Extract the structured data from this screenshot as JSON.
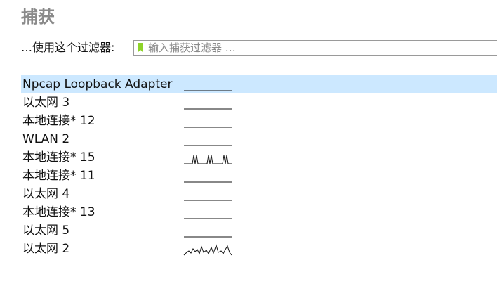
{
  "section": {
    "title": "捕获"
  },
  "filter": {
    "label": "…使用这个过滤器:",
    "placeholder": "输入捕获过滤器 …",
    "bookmark_color": "#8ed32a"
  },
  "interfaces": [
    {
      "name": "Npcap Loopback Adapter",
      "traffic": "flat",
      "selected": true
    },
    {
      "name": "以太网 3",
      "traffic": "flat",
      "selected": false
    },
    {
      "name": "本地连接* 12",
      "traffic": "flat",
      "selected": false
    },
    {
      "name": "WLAN 2",
      "traffic": "flat",
      "selected": false
    },
    {
      "name": "本地连接* 15",
      "traffic": "spikes",
      "selected": false
    },
    {
      "name": "本地连接* 11",
      "traffic": "flat",
      "selected": false
    },
    {
      "name": "以太网 4",
      "traffic": "flat",
      "selected": false
    },
    {
      "name": "本地连接* 13",
      "traffic": "flat",
      "selected": false
    },
    {
      "name": "以太网 5",
      "traffic": "flat",
      "selected": false
    },
    {
      "name": "以太网 2",
      "traffic": "busy",
      "selected": false
    }
  ],
  "colors": {
    "selection": "#cce8ff",
    "title": "#8a8a8a",
    "sparkline": "#111111"
  }
}
